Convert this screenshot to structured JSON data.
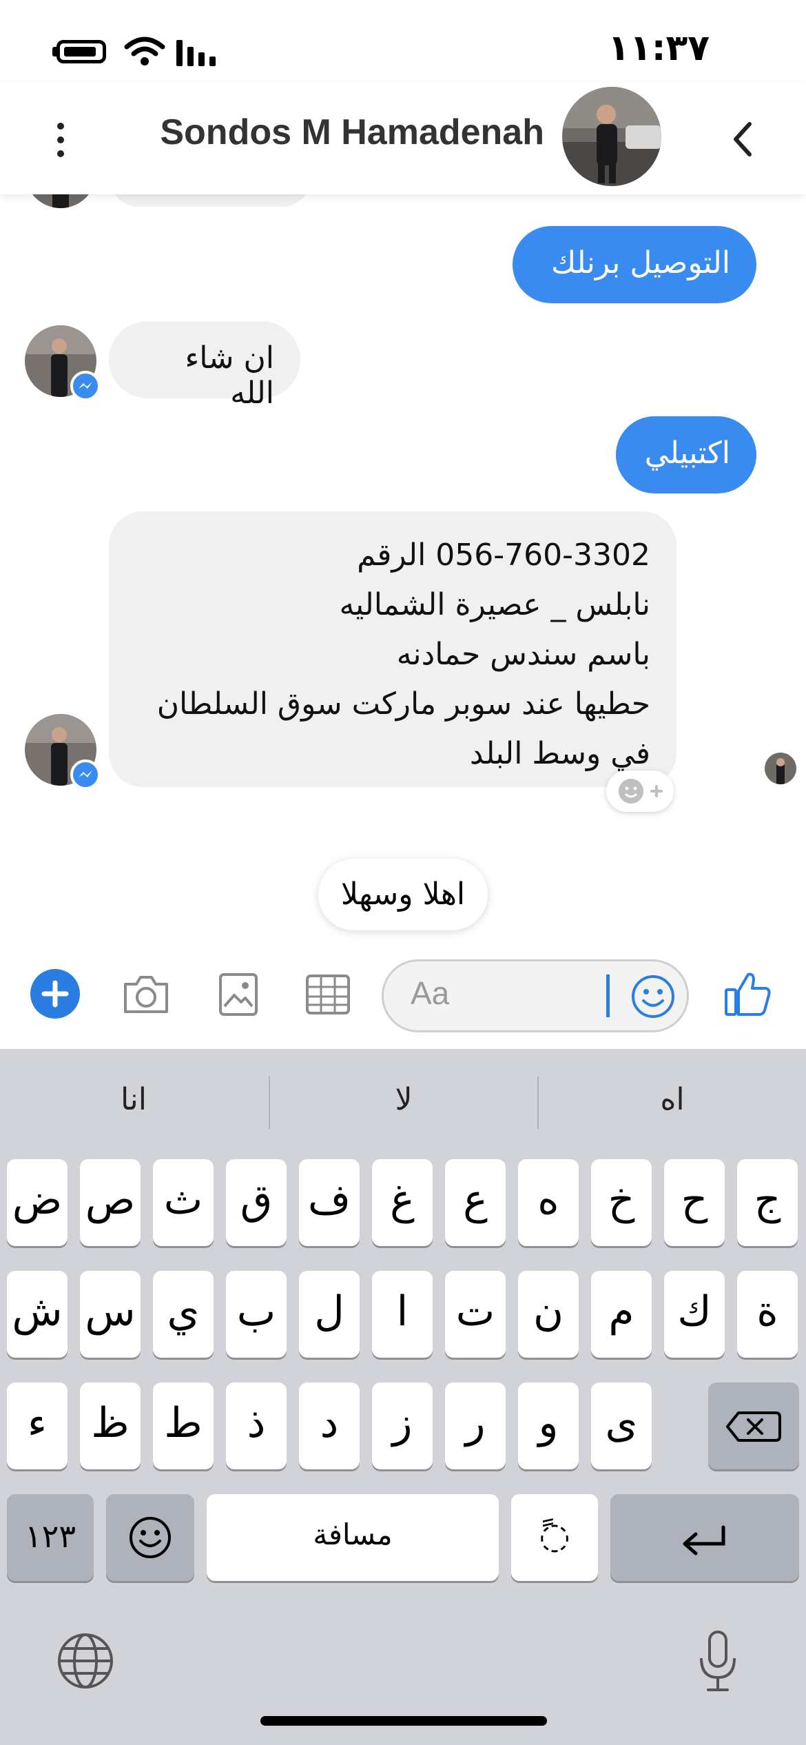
{
  "status_bar": {
    "time": "١١:٣٧"
  },
  "header": {
    "contact_name": "Sondos M Hamadenah"
  },
  "messages": {
    "out_1": "التوصيل برنلك",
    "in_1": "ان شاء الله",
    "out_2": "اكتبيلي",
    "in_2_lines": [
      "056-760-3302 الرقم",
      "نابلس _ عصيرة الشماليه",
      "باسم سندس حمادنه",
      "حطيها عند سوبر ماركت سوق السلطان",
      "في وسط البلد"
    ]
  },
  "quick_reply": "اهلا وسهلا",
  "composer": {
    "placeholder": "Aa"
  },
  "keyboard": {
    "suggestions": [
      "انا",
      "لا",
      "اه"
    ],
    "row1": [
      "ض",
      "ص",
      "ث",
      "ق",
      "ف",
      "غ",
      "ع",
      "ه",
      "خ",
      "ح",
      "ج"
    ],
    "row2": [
      "ش",
      "س",
      "ي",
      "ب",
      "ل",
      "ا",
      "ت",
      "ن",
      "م",
      "ك",
      "ة"
    ],
    "row3": [
      "ء",
      "ظ",
      "ط",
      "ذ",
      "د",
      "ز",
      "ر",
      "و",
      "ى"
    ],
    "numbers_key": "١٢٣",
    "space_key": "مسافة",
    "diacritic_key": "◌ً"
  },
  "colors": {
    "accent": "#3a8bf0",
    "keyboard_bg": "#d1d3d9"
  }
}
